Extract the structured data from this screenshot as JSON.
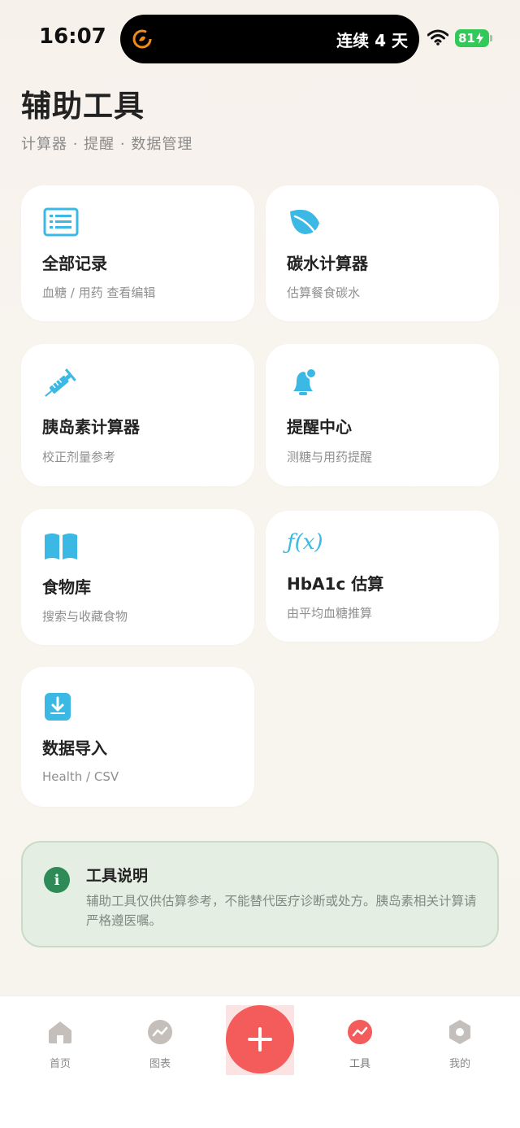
{
  "status_bar": {
    "time": "16:07",
    "activity_text": "连续 4 天",
    "battery": "81"
  },
  "header": {
    "title": "辅助工具",
    "subtitle": "计算器 · 提醒 · 数据管理"
  },
  "cards": [
    {
      "title": "全部记录",
      "desc": "血糖 / 用药 查看编辑",
      "icon": "list-icon"
    },
    {
      "title": "碳水计算器",
      "desc": "估算餐食碳水",
      "icon": "leaf-icon"
    },
    {
      "title": "胰岛素计算器",
      "desc": "校正剂量参考",
      "icon": "syringe-icon"
    },
    {
      "title": "提醒中心",
      "desc": "测糖与用药提醒",
      "icon": "bell-icon"
    },
    {
      "title": "食物库",
      "desc": "搜索与收藏食物",
      "icon": "book-icon"
    },
    {
      "title": "HbA1c 估算",
      "desc": "由平均血糖推算",
      "icon": "function-icon"
    },
    {
      "title": "数据导入",
      "desc": "Health / CSV",
      "icon": "import-icon"
    }
  ],
  "function_icon_text": "ƒ(x)",
  "info": {
    "icon_text": "i",
    "title": "工具说明",
    "body": "辅助工具仅供估算参考，不能替代医疗诊断或处方。胰岛素相关计算请严格遵医嘱。"
  },
  "tabbar": {
    "tabs": [
      {
        "label": "首页",
        "icon": "home-icon",
        "active": false
      },
      {
        "label": "图表",
        "icon": "chart-icon",
        "active": false
      },
      {
        "label": "工具",
        "icon": "tools-icon",
        "active": true
      },
      {
        "label": "我的",
        "icon": "profile-icon",
        "active": false
      }
    ],
    "fab_symbol": "+"
  },
  "colors": {
    "accent_blue": "#3bb8e4",
    "accent_red": "#f45b5b",
    "info_green": "#2e8a57",
    "inactive_gray": "#c4bfba"
  }
}
